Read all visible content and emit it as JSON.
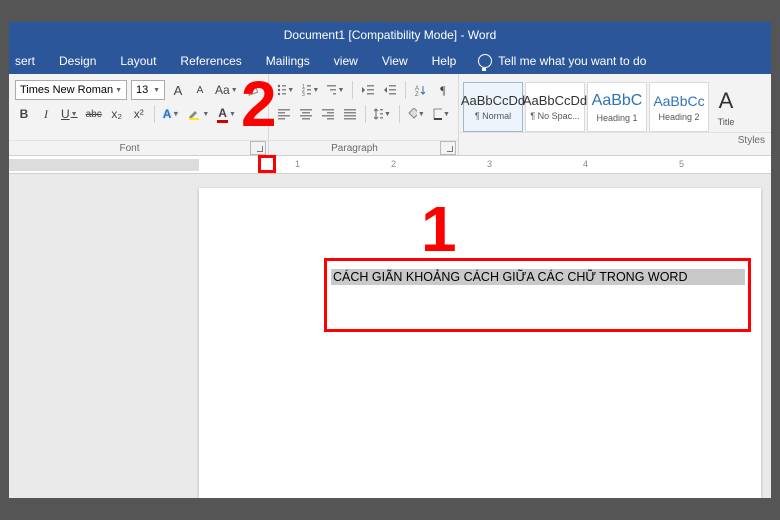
{
  "title": "Document1 [Compatibility Mode]  -  Word",
  "tabs": [
    "sert",
    "Design",
    "Layout",
    "References",
    "Mailings",
    "view",
    "View",
    "Help"
  ],
  "tellme": "Tell me what you want to do",
  "font": {
    "name": "Times New Roman",
    "size": "13",
    "group_label": "Font",
    "btn_incA": "A",
    "btn_decA": "A",
    "btn_case": "Aa",
    "btn_bold": "B",
    "btn_italic": "I",
    "btn_underline": "U",
    "btn_strike": "abc",
    "btn_sub": "x₂",
    "btn_sup": "x²",
    "btn_texteffects": "A",
    "btn_highlight": "A"
  },
  "paragraph": {
    "group_label": "Paragraph"
  },
  "styles": {
    "group_label": "Styles",
    "items": [
      {
        "sample": "AaBbCcDd",
        "name": "¶ Normal",
        "cls": ""
      },
      {
        "sample": "AaBbCcDd",
        "name": "¶ No Spac...",
        "cls": ""
      },
      {
        "sample": "AaBbC",
        "name": "Heading 1",
        "cls": "h1"
      },
      {
        "sample": "AaBbCc",
        "name": "Heading 2",
        "cls": "h2"
      },
      {
        "sample": "A",
        "name": "Title",
        "cls": "title"
      }
    ]
  },
  "ruler_numbers": [
    "1",
    "2",
    "3",
    "4",
    "5"
  ],
  "document_text": "CÁCH GIÃN KHOẢNG CÁCH GIỮA CÁC CHỮ TRONG WORD",
  "annotations": {
    "n1": "1",
    "n2": "2"
  }
}
